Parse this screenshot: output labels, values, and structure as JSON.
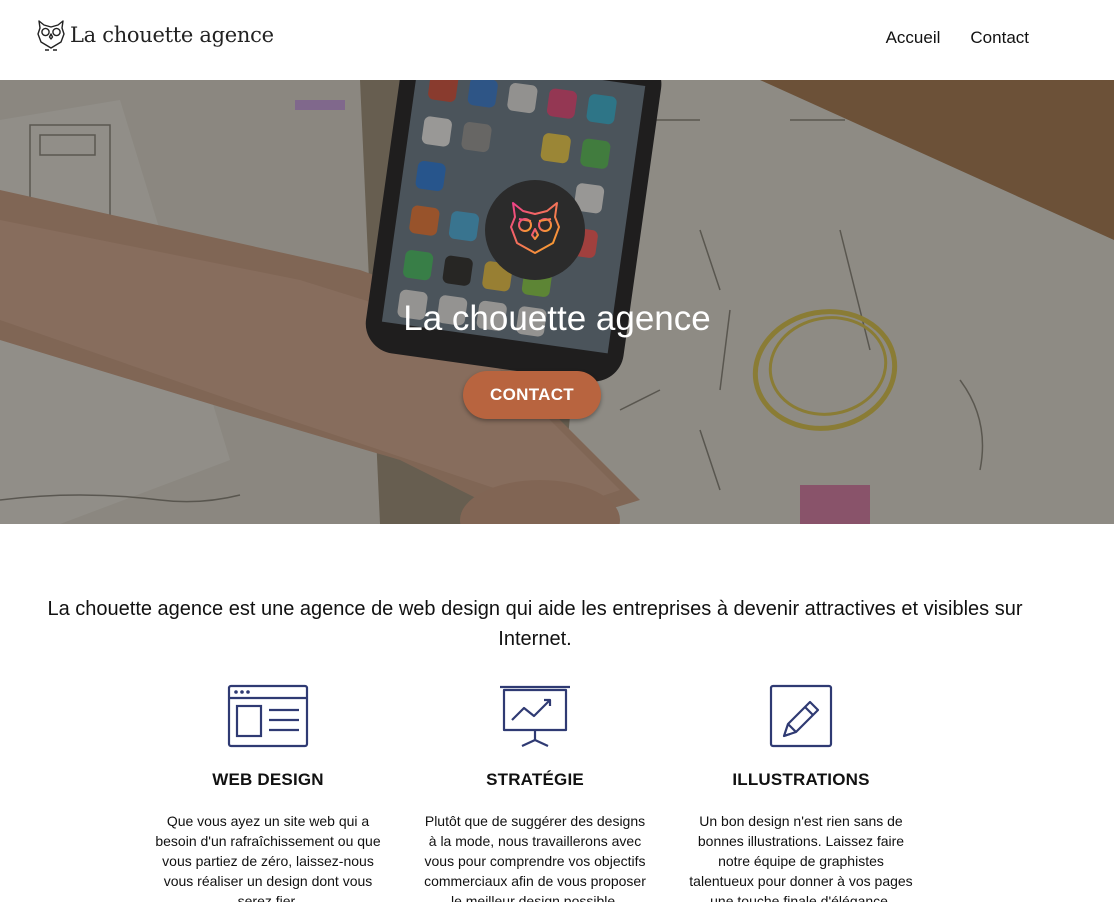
{
  "header": {
    "logo_text": "La chouette agence",
    "nav": [
      {
        "label": "Accueil"
      },
      {
        "label": "Contact"
      }
    ]
  },
  "hero": {
    "title": "La chouette agence",
    "cta_label": "CONTACT",
    "cta_color": "#b8643f",
    "badge_icon": "owl-icon"
  },
  "intro": {
    "text": "La chouette agence est une agence de web design qui aide les entreprises à devenir attractives et visibles sur Internet."
  },
  "services": [
    {
      "icon": "web-design-icon",
      "title": "WEB DESIGN",
      "text": "Que vous ayez un site web qui a besoin d'un rafraîchissement ou que vous partiez de zéro, laissez-nous vous réaliser un design dont vous serez fier."
    },
    {
      "icon": "strategy-chart-icon",
      "title": "STRATÉGIE",
      "text": "Plutôt que de suggérer des designs à la mode, nous travaillerons avec vous pour comprendre vos objectifs commerciaux afin de vous proposer le meilleur design possible."
    },
    {
      "icon": "pencil-icon",
      "title": "ILLUSTRATIONS",
      "text": "Un bon design n'est rien sans de bonnes illustrations. Laissez faire notre équipe de graphistes talentueux pour donner à vos pages une touche finale d'élégance."
    }
  ],
  "colors": {
    "icon_navy": "#2f3a73",
    "owl_gradient_start": "#f0408a",
    "owl_gradient_end": "#f9a825"
  }
}
